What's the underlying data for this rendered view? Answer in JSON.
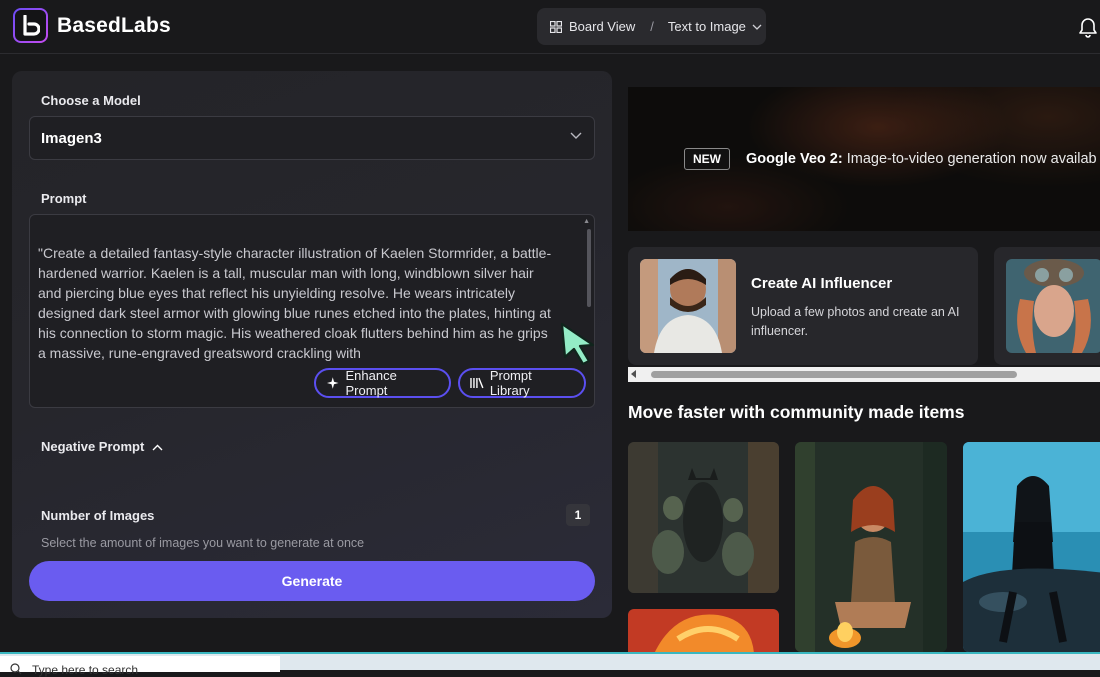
{
  "app": {
    "name": "BasedLabs"
  },
  "breadcrumb": {
    "board": "Board View",
    "separator": "/",
    "current": "Text to Image"
  },
  "form": {
    "model_label": "Choose a Model",
    "model_value": "Imagen3",
    "prompt_label": "Prompt",
    "prompt_text": "\"Create a detailed fantasy-style character illustration of Kaelen Stormrider, a battle-hardened warrior. Kaelen is a tall, muscular man with long, windblown silver hair and piercing blue eyes that reflect his unyielding resolve. He wears intricately designed dark steel armor with glowing blue runes etched into the plates, hinting at his connection to storm magic. His weathered cloak flutters behind him as he grips a massive, rune-engraved greatsword crackling with",
    "enhance_label": "Enhance Prompt",
    "library_label": "Prompt Library",
    "negative_label": "Negative Prompt",
    "num_images_label": "Number of Images",
    "num_images_value": "1",
    "num_images_help": "Select the amount of images you want to generate at once",
    "generate_label": "Generate"
  },
  "banner": {
    "tag": "NEW",
    "title": "Google Veo 2:",
    "text": " Image-to-video generation now availab"
  },
  "cards": [
    {
      "title": "Create AI Influencer",
      "desc": "Upload a few photos and create an AI influencer."
    }
  ],
  "community": {
    "title": "Move faster with community made items"
  },
  "taskbar": {
    "search_text": "Type here to search"
  },
  "colors": {
    "accent": "#6a5cf0",
    "background": "#19191b",
    "panel": "#242428"
  }
}
